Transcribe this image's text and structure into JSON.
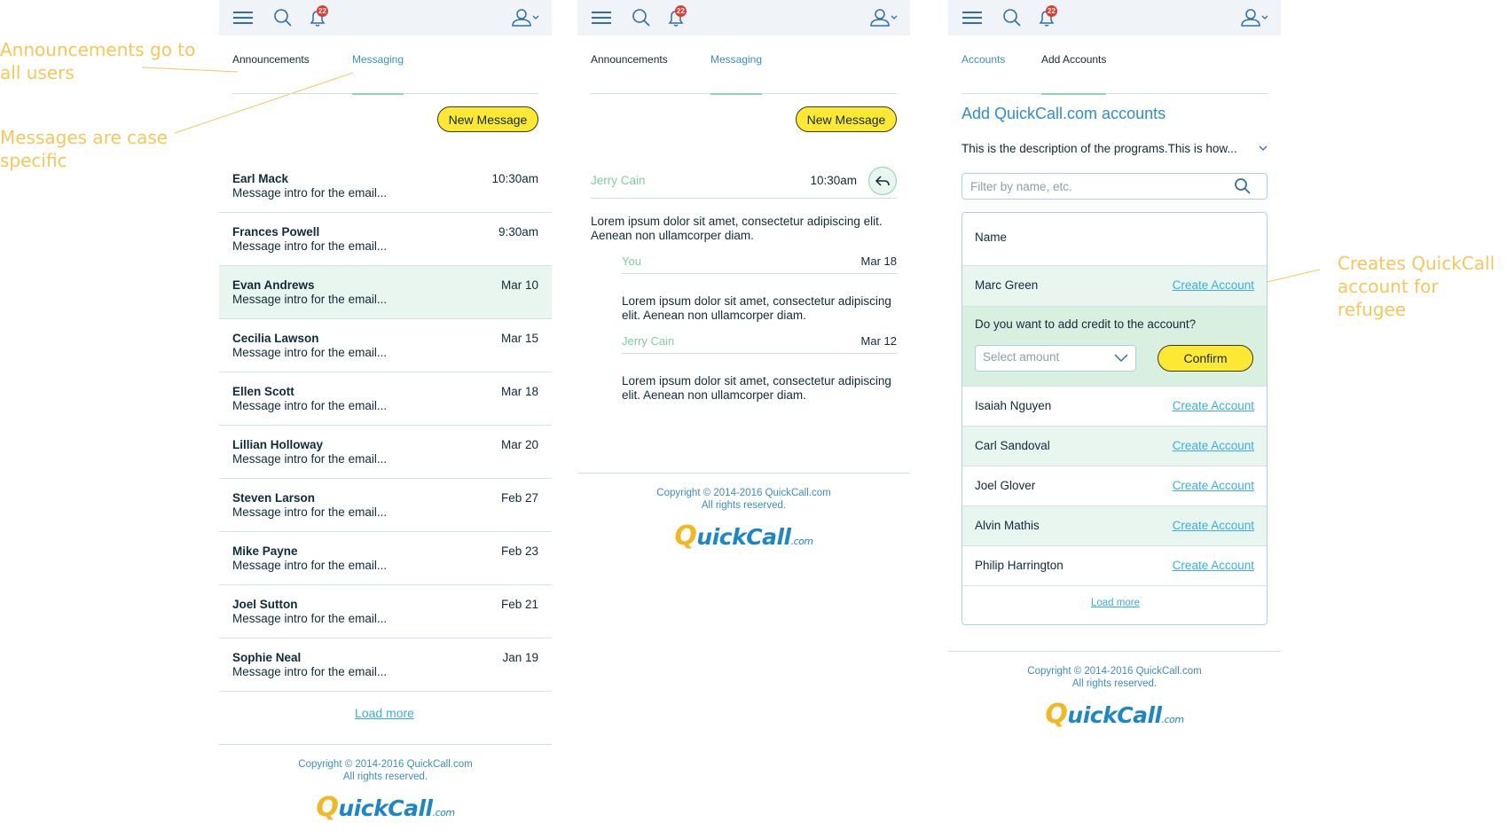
{
  "annotations": {
    "announcements_note": "Announcements go to all users",
    "messages_note": "Messages are case specific",
    "creates_note": "Creates QuickCall account for refugee"
  },
  "header": {
    "notification_count": "22"
  },
  "tabs_messages": {
    "announcements": "Announcements",
    "messaging": "Messaging"
  },
  "tabs_accounts": {
    "accounts": "Accounts",
    "add_accounts": "Add Accounts"
  },
  "list_screen": {
    "new_message_label": "New Message",
    "messages": [
      {
        "name": "Earl Mack",
        "intro": "Message intro for the email...",
        "time": "10:30am"
      },
      {
        "name": "Frances Powell",
        "intro": "Message intro for the email...",
        "time": "9:30am"
      },
      {
        "name": "Evan Andrews",
        "intro": "Message intro for the email...",
        "time": "Mar 10"
      },
      {
        "name": "Cecilia Lawson",
        "intro": "Message intro for the email...",
        "time": "Mar 15"
      },
      {
        "name": "Ellen Scott",
        "intro": "Message intro for the email...",
        "time": "Mar 18"
      },
      {
        "name": "Lillian Holloway",
        "intro": "Message intro for the email...",
        "time": "Mar 20"
      },
      {
        "name": "Steven Larson",
        "intro": "Message intro for the email...",
        "time": "Feb 27"
      },
      {
        "name": "Mike Payne",
        "intro": "Message intro for the email...",
        "time": "Feb 23"
      },
      {
        "name": "Joel Sutton",
        "intro": "Message intro for the email...",
        "time": "Feb 21"
      },
      {
        "name": "Sophie Neal",
        "intro": "Message intro for the email...",
        "time": "Jan 19"
      }
    ],
    "load_more": "Load more"
  },
  "thread_screen": {
    "new_message_label": "New Message",
    "sender": "Jerry Cain",
    "time": "10:30am",
    "body": "Lorem ipsum dolor sit amet, consectetur adipiscing elit. Aenean non ullamcorper diam.",
    "replies": [
      {
        "sender": "You",
        "date": "Mar 18",
        "body": "Lorem ipsum dolor sit amet, consectetur adipiscing elit. Aenean non ullamcorper diam."
      },
      {
        "sender": "Jerry Cain",
        "date": "Mar 12",
        "body": "Lorem ipsum dolor sit amet, consectetur adipiscing elit. Aenean non ullamcorper diam."
      }
    ]
  },
  "accounts_screen": {
    "title": "Add QuickCall.com accounts",
    "description": "This is the description of the programs.This is how...",
    "filter_placeholder": "Filter by name, etc.",
    "name_header": "Name",
    "create_label": "Create Account",
    "first_user": "Marc Green",
    "credit_question": "Do you want to add credit to the account?",
    "select_placeholder": "Select amount",
    "confirm_label": "Confirm",
    "users": [
      "Isaiah Nguyen",
      "Carl Sandoval",
      "Joel Glover",
      "Alvin Mathis",
      "Philip Harrington"
    ],
    "load_more": "Load more"
  },
  "footer": {
    "copyright": "Copyright © 2014-2016 QuickCall.com",
    "rights": "All rights reserved.",
    "logo_q": "Q",
    "logo_text": "uickCall",
    "logo_com": ".com"
  },
  "colors": {
    "accent": "#3a8fc1",
    "highlight": "#e9f6ef",
    "button": "#fde933",
    "annotation": "#f5c75a"
  }
}
